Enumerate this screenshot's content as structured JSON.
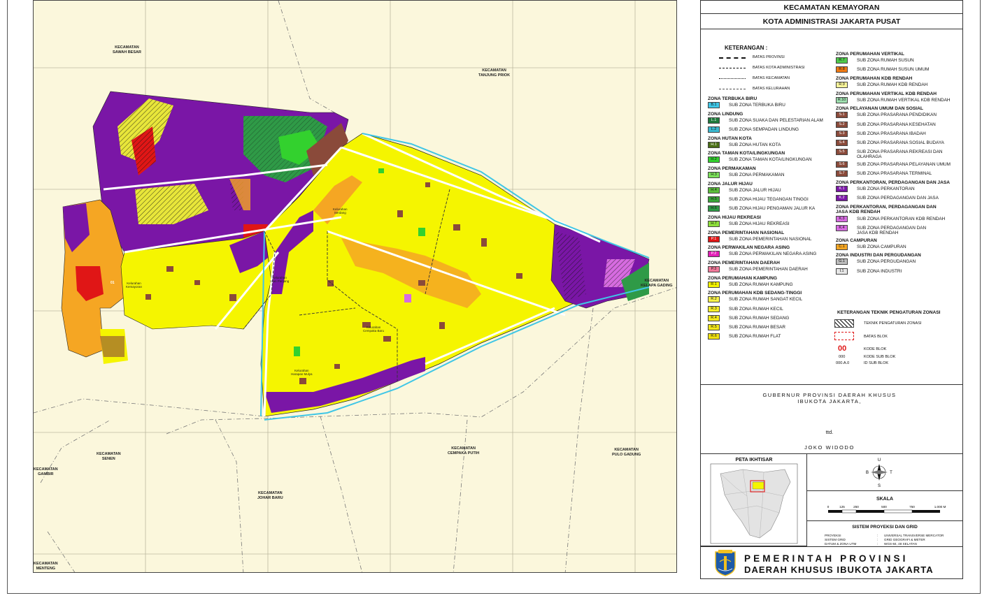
{
  "header": {
    "district": "KECAMATAN KEMAYORAN",
    "city": "KOTA ADMINISTRASI JAKARTA PUSAT"
  },
  "map": {
    "neighbors": {
      "sawah_besar": "KECAMATAN\nSAWAH BESAR",
      "tanjung_priok": "KECAMATAN\nTANJUNG PRIOK",
      "kelapa_gading": "KECAMATAN\nKELAPA GADING",
      "senen": "KECAMATAN\nSENEN",
      "gambir": "KECAMATAN\nGAMBIR",
      "cempaka_putih": "KECAMATAN\nCEMPAKA PUTIH",
      "pulo_gadung": "KECAMATAN\nPULO GADUNG",
      "johar_baru": "KECAMATAN\nJOHAR BARU",
      "menteng": "KECAMATAN\nMENTENG"
    },
    "kelurahan": {
      "kemayoran": "Kelurahan\nKemayoran",
      "serdang": "Kelurahan\nSerdang",
      "utan_panjang": "Kelurahan\nUtan Panjang",
      "cempaka_baru": "Kelurahan\nCempaka Baru",
      "harapan_mulya": "Kelurahan\nHarapan Mulya"
    },
    "block_code_sample": "01"
  },
  "legend": {
    "title": "KETERANGAN :",
    "lines": [
      {
        "label": "BATAS PROVINSI"
      },
      {
        "label": "BATAS KOTA ADMINISTRASI"
      },
      {
        "label": "BATAS KECAMATAN"
      },
      {
        "label": "BATAS KELURAHAN"
      }
    ],
    "left_groups": [
      {
        "head": "ZONA TERBUKA BIRU",
        "items": [
          {
            "code": "B.1",
            "label": "SUB ZONA TERBUKA BIRU",
            "color": "#3fc6e6"
          }
        ]
      },
      {
        "head": "ZONA LINDUNG",
        "items": [
          {
            "code": "L.1",
            "label": "SUB ZONA SUAKA DAN PELESTARIAN ALAM",
            "color": "#1f7a3c"
          },
          {
            "code": "L.2",
            "label": "SUB ZONA SEMPADAN LINDUNG",
            "color": "#3ab8cf"
          }
        ]
      },
      {
        "head": "ZONA HUTAN KOTA",
        "items": [
          {
            "code": "H.1",
            "label": "SUB ZONA HUTAN KOTA",
            "color": "#4a6e16"
          }
        ]
      },
      {
        "head": "ZONA TAMAN KOTA/LINGKUNGAN",
        "items": [
          {
            "code": "H.2",
            "label": "SUB ZONA TAMAN KOTA/LINGKUNGAN",
            "color": "#33d12e"
          }
        ]
      },
      {
        "head": "ZONA PERMAKAMAN",
        "items": [
          {
            "code": "H.3",
            "label": "SUB ZONA PERMAKAMAN",
            "color": "#7be05a"
          }
        ]
      },
      {
        "head": "ZONA JALUR HIJAU",
        "items": [
          {
            "code": "H.4",
            "label": "SUB ZONA JALUR HIJAU",
            "color": "#5cbf3c"
          },
          {
            "code": "H.5",
            "label": "SUB ZONA HIJAU TEGANGAN TINGGI",
            "color": "#3aa63a"
          },
          {
            "code": "H.6",
            "label": "SUB ZONA HIJAU PENGAMAN JALUR KA",
            "color": "#2f9a47"
          }
        ]
      },
      {
        "head": "ZONA HIJAU REKREASI",
        "items": [
          {
            "code": "H.7",
            "label": "SUB ZONA HIJAU REKREASI",
            "color": "#8ee03c"
          }
        ]
      },
      {
        "head": "ZONA PEMERINTAHAN NASIONAL",
        "items": [
          {
            "code": "P.1",
            "label": "SUB ZONA PEMERINTAHAN NASIONAL",
            "color": "#e01616"
          }
        ]
      },
      {
        "head": "ZONA PERWAKILAN NEGARA ASING",
        "items": [
          {
            "code": "P.2",
            "label": "SUB ZONA PERWAKILAN NEGARA ASING",
            "color": "#e21fb6"
          }
        ]
      },
      {
        "head": "ZONA PEMERINTAHAN DAERAH",
        "items": [
          {
            "code": "P.3",
            "label": "SUB ZONA PEMERINTAHAN DAERAH",
            "color": "#f07a9a"
          }
        ]
      },
      {
        "head": "ZONA PERUMAHAN KAMPUNG",
        "items": [
          {
            "code": "R.1",
            "label": "SUB ZONA RUMAH KAMPUNG",
            "color": "#f5f500"
          }
        ]
      },
      {
        "head": "ZONA PERUMAHAN KDB SEDANG-TINGGI",
        "items": [
          {
            "code": "R.2",
            "label": "SUB ZONA RUMAH SANGAT KECIL",
            "color": "#f7f24a"
          },
          {
            "code": "R.3",
            "label": "SUB ZONA RUMAH KECIL",
            "color": "#f7ee2a"
          },
          {
            "code": "R.4",
            "label": "SUB ZONA RUMAH SEDANG",
            "color": "#f4ea20"
          },
          {
            "code": "R.5",
            "label": "SUB ZONA RUMAH BESAR",
            "color": "#f2e618"
          },
          {
            "code": "R.6",
            "label": "SUB ZONA RUMAH FLAT",
            "color": "#f0e210"
          }
        ]
      }
    ],
    "right_groups": [
      {
        "head": "ZONA PERUMAHAN VERTIKAL",
        "items": [
          {
            "code": "R.7",
            "label": "SUB ZONA RUMAH SUSUN",
            "color": "#4fc94b"
          },
          {
            "code": "R.8",
            "label": "SUB ZONA RUMAH SUSUN UMUM",
            "color": "#f07a14"
          }
        ]
      },
      {
        "head": "ZONA PERUMAHAN KDB RENDAH",
        "items": [
          {
            "code": "R.9",
            "label": "SUB ZONA RUMAH KDB RENDAH",
            "color": "#fbf69a"
          }
        ]
      },
      {
        "head": "ZONA PERUMAHAN VERTIKAL KDB RENDAH",
        "items": [
          {
            "code": "R.10",
            "label": "SUB ZONA RUMAH VERTIKAL KDB RENDAH",
            "color": "#9fe0b0"
          }
        ]
      },
      {
        "head": "ZONA PELAYANAN UMUM DAN SOSIAL",
        "items": [
          {
            "code": "S.1",
            "label": "SUB ZONA PRASARANA PENDIDIKAN",
            "color": "#8a4a3a"
          },
          {
            "code": "S.2",
            "label": "SUB ZONA PRASARANA KESEHATAN",
            "color": "#8a4a3a"
          },
          {
            "code": "S.3",
            "label": "SUB ZONA PRASARANA IBADAH",
            "color": "#8a4a3a"
          },
          {
            "code": "S.4",
            "label": "SUB ZONA PRASARANA SOSIAL BUDAYA",
            "color": "#8a4a3a"
          },
          {
            "code": "S.5",
            "label": "SUB ZONA PRASARANA REKREASI DAN\nOLAHRAGA",
            "color": "#8a4a3a"
          },
          {
            "code": "S.6",
            "label": "SUB ZONA PRASARANA PELAYANAN UMUM",
            "color": "#8a4a3a"
          },
          {
            "code": "S.7",
            "label": "SUB ZONA PRASARANA TERMINAL",
            "color": "#8a4a3a"
          }
        ]
      },
      {
        "head": "ZONA PERKANTORAN, PERDAGANGAN DAN JASA",
        "items": [
          {
            "code": "K.1",
            "label": "SUB ZONA PERKANTORAN",
            "color": "#7a16a6"
          },
          {
            "code": "K.2",
            "label": "SUB ZONA PERDAGANGAN DAN JASA",
            "color": "#7a16a6"
          }
        ]
      },
      {
        "head": "ZONA PERKANTORAN, PERDAGANGAN DAN\nJASA KDB RENDAH",
        "items": [
          {
            "code": "K.3",
            "label": "SUB ZONA PERKANTORAN KDB RENDAH",
            "color": "#d66be0"
          },
          {
            "code": "K.4",
            "label": "SUB ZONA PERDAGANGAN DAN\nJASA KDB RENDAH",
            "color": "#d66be0"
          }
        ]
      },
      {
        "head": "ZONA CAMPURAN",
        "items": [
          {
            "code": "C.1",
            "label": "SUB ZONA CAMPURAN",
            "color": "#f5a623"
          }
        ]
      },
      {
        "head": "ZONA INDUSTRI DAN PERGUDANGAN",
        "items": [
          {
            "code": "G.1",
            "label": "SUB ZONA PERGUDANGAN",
            "color": "#bdbdbd"
          },
          {
            "code": "I.1",
            "label": "SUB ZONA INDUSTRI",
            "color": "#e6e6e6"
          }
        ]
      }
    ],
    "technique": {
      "head": "KETERANGAN TEKNIK PENGATURAN ZONASI",
      "hatch_label": "TEKNIK PENGATURAN ZONASI",
      "block_label": "BATAS BLOK",
      "kode_blok_sample": "00",
      "kode_blok_label": "KODE BLOK",
      "kode_sub_sample": "000",
      "kode_sub_label": "KODE SUB BLOK",
      "id_sub_sample": "000.A.0",
      "id_sub_label": "ID SUB BLOK"
    }
  },
  "signature": {
    "title": "GUBERNUR PROVINSI DAERAH KHUSUS\nIBUKOTA JAKARTA,",
    "ttd": "ttd.",
    "name": "JOKO WIDODO"
  },
  "ikhtisar": {
    "title": "PETA IKHTISAR"
  },
  "compass": {
    "n": "U",
    "s": "S",
    "e": "T",
    "w": "B"
  },
  "scale": {
    "title": "SKALA",
    "ticks": [
      "0",
      "125",
      "250",
      "500",
      "750",
      "1.000 M"
    ]
  },
  "projection": {
    "title": "SISTEM PROYEKSI DAN GRID",
    "rows": [
      {
        "k": "PROYEKSI",
        "v": "UNIVERSAL TRANSVERSE MERCATOR"
      },
      {
        "k": "SISTEM GRID",
        "v": "GRID GEOGRAFI & METER"
      },
      {
        "k": "DATUM & ZONA UTM",
        "v": "WGS-84, 48 SELATAN"
      }
    ]
  },
  "government": {
    "line1": "PEMERINTAH PROVINSI",
    "line2": "DAERAH KHUSUS IBUKOTA JAKARTA",
    "emblem_text": "JAYA RAYA"
  }
}
